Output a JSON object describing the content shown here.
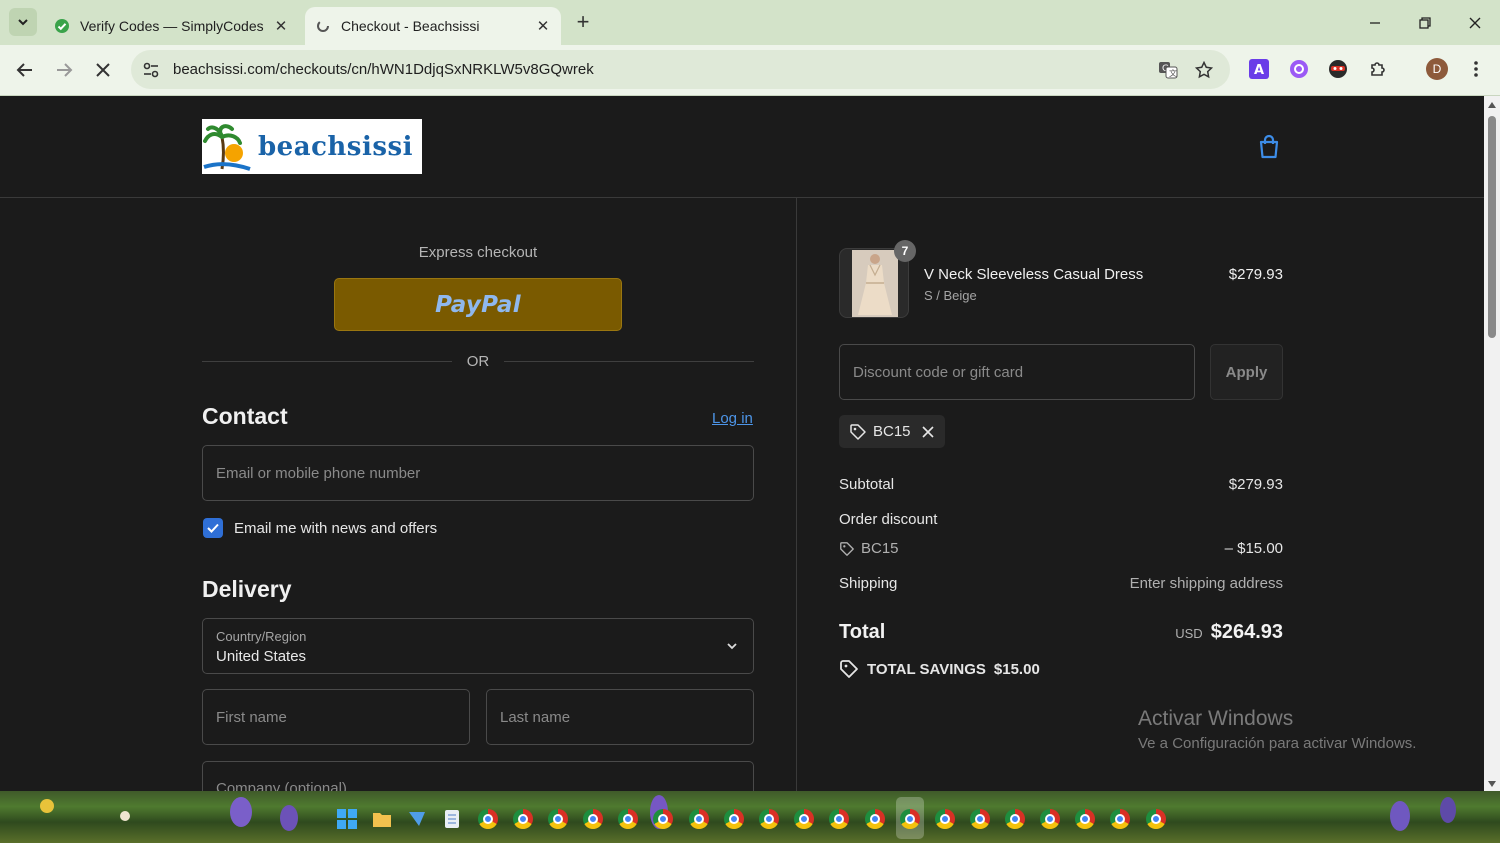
{
  "browser": {
    "tabs": [
      {
        "title": "Verify Codes — SimplyCodes",
        "active": false
      },
      {
        "title": "Checkout - Beachsissi",
        "active": true
      }
    ],
    "url": "beachsissi.com/checkouts/cn/hWN1DdjqSxNRKLW5v8GQwrek",
    "profile_initial": "D"
  },
  "store": {
    "logo_text": "beachsissi"
  },
  "checkout": {
    "express_label": "Express checkout",
    "paypal_label": "PayPal",
    "or_label": "OR",
    "contact": {
      "title": "Contact",
      "login_label": "Log in",
      "email_placeholder": "Email or mobile phone number",
      "newsletter_label": "Email me with news and offers",
      "newsletter_checked": true
    },
    "delivery": {
      "title": "Delivery",
      "country_label": "Country/Region",
      "country_value": "United States",
      "first_name_placeholder": "First name",
      "last_name_placeholder": "Last name",
      "company_placeholder": "Company (optional)"
    }
  },
  "summary": {
    "item": {
      "name": "V Neck Sleeveless Casual Dress",
      "variant": "S / Beige",
      "price": "$279.93",
      "quantity": "7"
    },
    "discount_placeholder": "Discount code or gift card",
    "apply_label": "Apply",
    "applied_code": "BC15",
    "subtotal_label": "Subtotal",
    "subtotal_value": "$279.93",
    "order_discount_label": "Order discount",
    "discount_code": "BC15",
    "discount_value": "– $15.00",
    "shipping_label": "Shipping",
    "shipping_value": "Enter shipping address",
    "total_label": "Total",
    "total_currency": "USD",
    "total_value": "$264.93",
    "savings_label": "TOTAL SAVINGS",
    "savings_value": "$15.00"
  },
  "os_watermark": {
    "line1": "Activar Windows",
    "line2": "Ve a Configuración para activar Windows."
  },
  "colors": {
    "accent_blue": "#2f6fd6",
    "link": "#4d95e8",
    "paypal_bg": "#7a5a00",
    "page_bg": "#1b1b1b"
  }
}
